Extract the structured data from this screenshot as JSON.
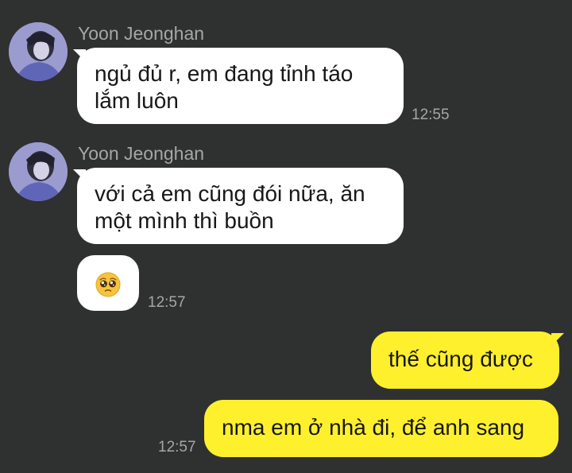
{
  "chat": {
    "contact_name": "Yoon Jeonghan",
    "messages": [
      {
        "sender": "Yoon Jeonghan",
        "text_line1": "ngủ đủ r, em đang tỉnh táo",
        "text_line2": "lắm luôn",
        "time": "12:55"
      },
      {
        "sender": "Yoon Jeonghan",
        "text_line1": "với cả em cũng đói nữa, ăn",
        "text_line2": "một mình thì buồn"
      },
      {
        "emoji": "pleading-face",
        "time": "12:57"
      },
      {
        "text": "thế cũng được"
      },
      {
        "text": "nma em ở nhà đi, để anh sang",
        "time": "12:57"
      }
    ]
  },
  "colors": {
    "background": "#2f3030",
    "incoming_bubble": "#ffffff",
    "outgoing_bubble": "#fff02e",
    "meta_text": "#a6a6a6"
  }
}
